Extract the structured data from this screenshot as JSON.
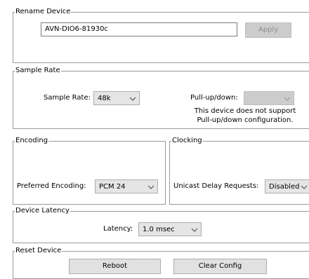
{
  "rename_device": {
    "legend": "Rename Device",
    "name_value": "AVN-DIO6-81930c",
    "apply_label": "Apply"
  },
  "sample_rate": {
    "legend": "Sample Rate",
    "rate_label": "Sample Rate:",
    "rate_value": "48k",
    "pullup_label": "Pull-up/down:",
    "pullup_value": "",
    "note_line1": "This device does not support",
    "note_line2": "Pull-up/down configuration."
  },
  "encoding": {
    "legend": "Encoding",
    "preferred_label": "Preferred Encoding:",
    "preferred_value": "PCM 24"
  },
  "clocking": {
    "legend": "Clocking",
    "unicast_label": "Unicast Delay Requests:",
    "unicast_value": "Disabled"
  },
  "device_latency": {
    "legend": "Device Latency",
    "latency_label": "Latency:",
    "latency_value": "1.0 msec"
  },
  "reset_device": {
    "legend": "Reset Device",
    "reboot_label": "Reboot",
    "clear_config_label": "Clear Config"
  },
  "icons": {
    "dropdown": "chevron-down-icon"
  }
}
